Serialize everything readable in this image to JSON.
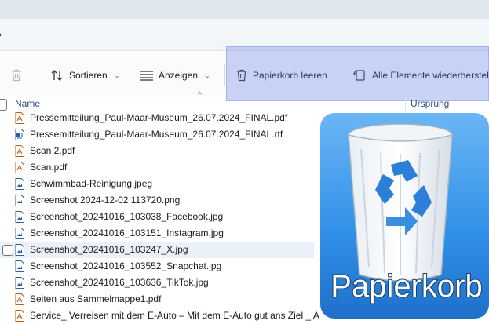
{
  "address": {
    "chevron": "›"
  },
  "toolbar": {
    "delete_icon": "trash-icon",
    "sort_label": "Sortieren",
    "view_label": "Anzeigen",
    "empty_bin_label": "Papierkorb leeren",
    "restore_all_label": "Alle Elemente wiederherstell"
  },
  "columns": {
    "name": "Name",
    "origin": "Ursprung"
  },
  "files": [
    {
      "name": "Pressemitteilung_Paul-Maar-Museum_26.07.2024_FINAL.pdf",
      "type": "pdf"
    },
    {
      "name": "Pressemitteilung_Paul-Maar-Museum_26.07.2024_FINAL.rtf",
      "type": "doc"
    },
    {
      "name": "Scan 2.pdf",
      "type": "pdf"
    },
    {
      "name": "Scan.pdf",
      "type": "pdf"
    },
    {
      "name": "Schwimmbad-Reinigung.jpeg",
      "type": "img"
    },
    {
      "name": "Screenshot 2024-12-02 113720.png",
      "type": "img"
    },
    {
      "name": "Screenshot_20241016_103038_Facebook.jpg",
      "type": "img"
    },
    {
      "name": "Screenshot_20241016_103151_Instagram.jpg",
      "type": "img"
    },
    {
      "name": "Screenshot_20241016_103247_X.jpg",
      "type": "img",
      "selected": true
    },
    {
      "name": "Screenshot_20241016_103552_Snapchat.jpg",
      "type": "img"
    },
    {
      "name": "Screenshot_20241016_103636_TikTok.jpg",
      "type": "img"
    },
    {
      "name": "Seiten aus Sammelmappe1.pdf",
      "type": "pdf"
    },
    {
      "name": "Service_ Verreisen mit dem E-Auto – Mit dem E-Auto gut ans Ziel _ A",
      "type": "pdf"
    }
  ],
  "overlay": {
    "label": "Papierkorb",
    "icon": "recycle-bin-icon",
    "accent": "#4a8fe0",
    "highlight": "#5c7ce6"
  }
}
